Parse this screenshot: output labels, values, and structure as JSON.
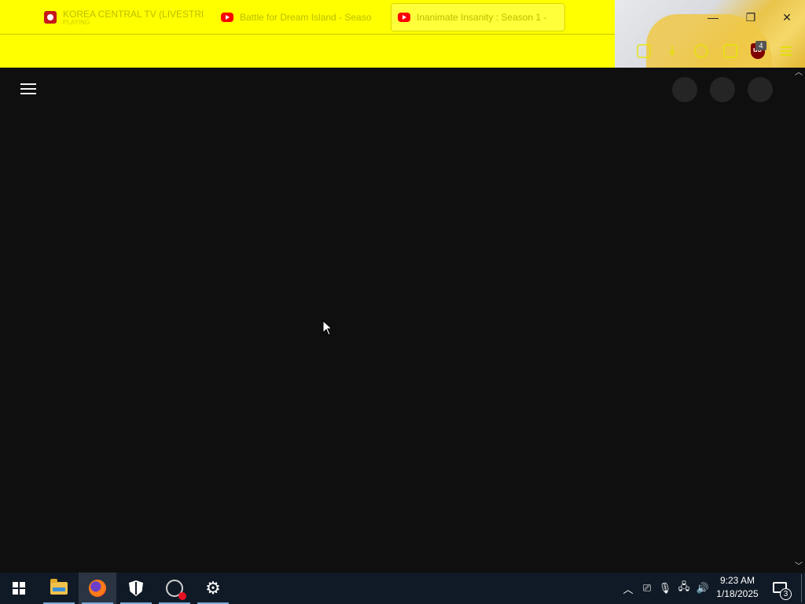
{
  "browser": {
    "tabs": [
      {
        "title": "KOREA CENTRAL TV (LIVESTRE",
        "subtitle": "PLAYING",
        "favicon": "kcna-icon",
        "active": false
      },
      {
        "title": "Battle for Dream Island - Seaso",
        "subtitle": "",
        "favicon": "youtube-icon",
        "active": false
      },
      {
        "title": "Inanimate Insanity : Season 1 -",
        "subtitle": "",
        "favicon": "youtube-icon",
        "active": true
      }
    ],
    "window_controls": {
      "minimize": "—",
      "maximize": "❐",
      "close": "✕"
    },
    "toolbar_icons": [
      "pocket-icon",
      "download-icon",
      "account-icon",
      "extensions-icon",
      "ublock-icon",
      "menu-icon"
    ],
    "ublock_badge": "4",
    "theme_color": "#ffff00"
  },
  "page": {
    "background": "#0f0f0f",
    "menu_icon": "hamburger-icon",
    "skeleton_buttons": 3
  },
  "taskbar": {
    "apps": [
      "windows-start-icon",
      "file-explorer-icon",
      "firefox-icon",
      "security-icon",
      "obs-icon",
      "settings-icon"
    ],
    "tray_icons": [
      "chevron-up-icon",
      "meet-now-icon",
      "microphone-icon",
      "network-icon",
      "volume-icon"
    ],
    "time": "9:23 AM",
    "date": "1/18/2025",
    "notification_count": "3"
  }
}
